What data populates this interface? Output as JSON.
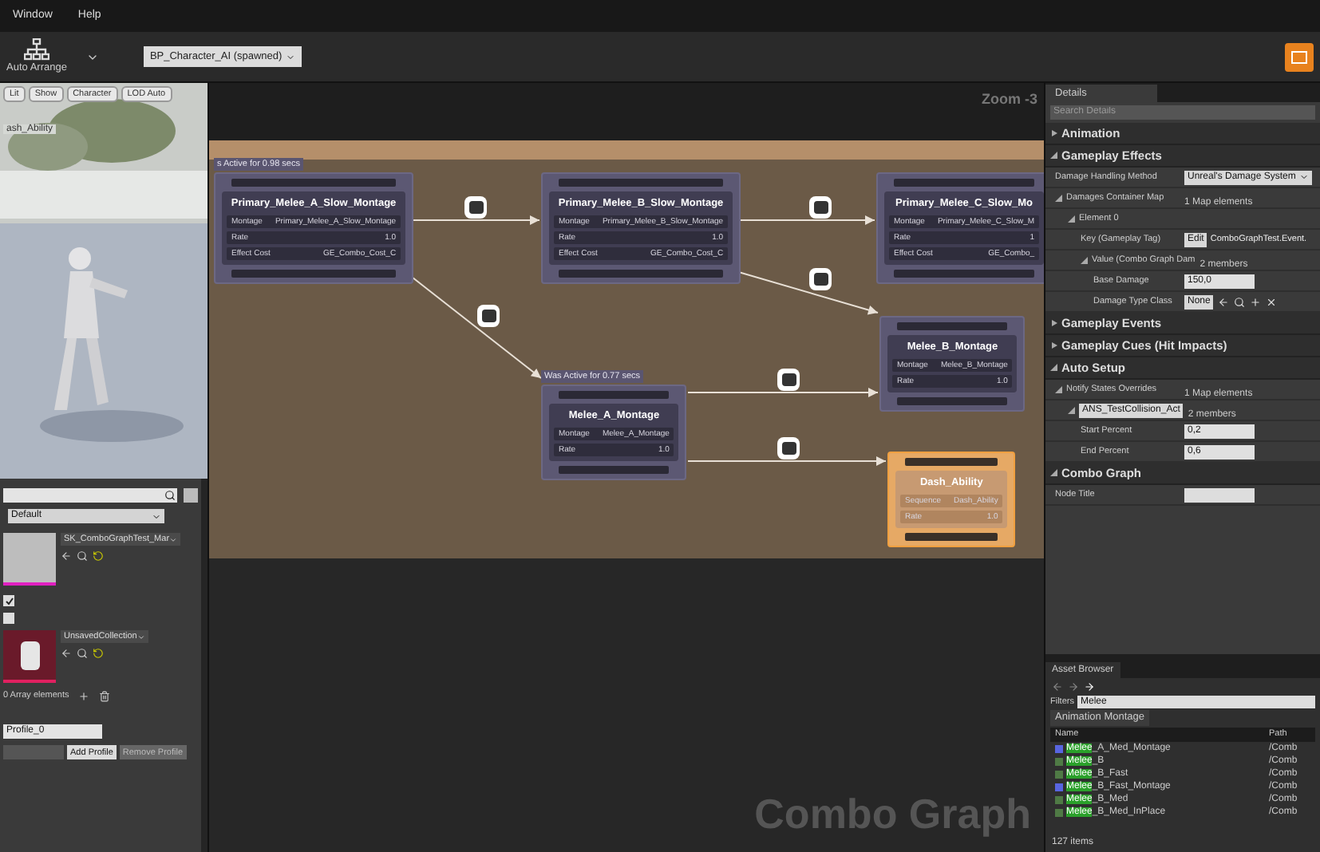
{
  "menu": [
    "Window",
    "Help"
  ],
  "toolbar": {
    "auto_arrange": "Auto Arrange",
    "blueprint_dropdown": "BP_Character_AI (spawned)"
  },
  "viewport": {
    "buttons": [
      "Lit",
      "Show",
      "Character",
      "LOD Auto"
    ],
    "overlay_label": "ash_Ability"
  },
  "preview_panel": {
    "profile_dropdown": "Default",
    "mesh": "SK_ComboGraphTest_Mar",
    "checkboxes": [
      {
        "checked": true
      },
      {
        "checked": false
      }
    ],
    "collection": "UnsavedCollection",
    "array_count": "0 Array elements",
    "profile_name": "Profile_0",
    "buttons": [
      "Add Profile",
      "Remove Profile"
    ]
  },
  "graph": {
    "zoom": "Zoom -3",
    "watermark": "Combo Graph",
    "nodes": [
      {
        "title": "Primary_Melee_A_Slow_Montage",
        "status": "s Active for 0.98 secs",
        "selected": false,
        "rows": [
          {
            "label": "Montage",
            "value": "Primary_Melee_A_Slow_Montage"
          },
          {
            "label": "Rate",
            "value": "1.0"
          },
          {
            "label": "Effect Cost",
            "value": "GE_Combo_Cost_C"
          }
        ]
      },
      {
        "title": "Primary_Melee_B_Slow_Montage",
        "selected": false,
        "rows": [
          {
            "label": "Montage",
            "value": "Primary_Melee_B_Slow_Montage"
          },
          {
            "label": "Rate",
            "value": "1.0"
          },
          {
            "label": "Effect Cost",
            "value": "GE_Combo_Cost_C"
          }
        ]
      },
      {
        "title": "Primary_Melee_C_Slow_Mo",
        "selected": false,
        "rows": [
          {
            "label": "Montage",
            "value": "Primary_Melee_C_Slow_M"
          },
          {
            "label": "Rate",
            "value": "1"
          },
          {
            "label": "Effect Cost",
            "value": "GE_Combo_"
          }
        ]
      },
      {
        "title": "Melee_B_Montage",
        "selected": false,
        "rows": [
          {
            "label": "Montage",
            "value": "Melee_B_Montage"
          },
          {
            "label": "Rate",
            "value": "1.0"
          }
        ]
      },
      {
        "title": "Melee_A_Montage",
        "status": "Was Active for 0.77 secs",
        "selected": false,
        "rows": [
          {
            "label": "Montage",
            "value": "Melee_A_Montage"
          },
          {
            "label": "Rate",
            "value": "1.0"
          }
        ]
      },
      {
        "title": "Dash_Ability",
        "selected": true,
        "rows": [
          {
            "label": "Sequence",
            "value": "Dash_Ability"
          },
          {
            "label": "Rate",
            "value": "1.0"
          }
        ]
      }
    ]
  },
  "details": {
    "tab": "Details",
    "search": {
      "placeholder": "Search Details"
    },
    "sections": [
      {
        "title": "Animation",
        "expanded": false
      },
      {
        "title": "Gameplay Effects",
        "expanded": true,
        "rows": [
          {
            "kind": "dropdown",
            "label": "Damage Handling Method",
            "value": "Unreal's Damage System"
          },
          {
            "kind": "map",
            "label": "Damages Container Map",
            "value": "1 Map elements",
            "expanded": true,
            "children": [
              {
                "kind": "group",
                "label": "Element 0",
                "expanded": true,
                "children": [
                  {
                    "kind": "tag",
                    "label": "Key (Gameplay Tag)",
                    "button": "Edit",
                    "value": "ComboGraphTest.Event."
                  },
                  {
                    "kind": "struct",
                    "label": "Value (Combo Graph Dam",
                    "value": "2 members",
                    "expanded": true,
                    "children": [
                      {
                        "kind": "number",
                        "label": "Base Damage",
                        "value": "150,0"
                      },
                      {
                        "kind": "class",
                        "label": "Damage Type Class",
                        "value": "None"
                      }
                    ]
                  }
                ]
              }
            ]
          }
        ]
      },
      {
        "title": "Gameplay Events",
        "expanded": false
      },
      {
        "title": "Gameplay Cues (Hit Impacts)",
        "expanded": false
      },
      {
        "title": "Auto Setup",
        "expanded": true,
        "rows": [
          {
            "kind": "map",
            "label": "Notify States Overrides",
            "value": "1 Map elements",
            "expanded": true,
            "children": [
              {
                "kind": "keystruct",
                "label": "ANS_TestCollision_Act",
                "value": "2 members",
                "expanded": true,
                "children": [
                  {
                    "kind": "number",
                    "label": "Start Percent",
                    "value": "0,2"
                  },
                  {
                    "kind": "number",
                    "label": "End Percent",
                    "value": "0,6"
                  }
                ]
              }
            ]
          }
        ]
      },
      {
        "title": "Combo Graph",
        "expanded": true,
        "rows": [
          {
            "kind": "text",
            "label": "Node Title"
          }
        ]
      }
    ]
  },
  "asset_browser": {
    "tab": "Asset Browser",
    "filters_label": "Filters",
    "search": "Melee",
    "filter_chip": "Animation Montage",
    "columns": [
      "Name",
      "Path"
    ],
    "rows": [
      {
        "match": "Melee",
        "rest": "_A_Med_Montage",
        "path": "/Comb",
        "color": "#5865e0"
      },
      {
        "match": "Melee",
        "rest": "_B",
        "path": "/Comb",
        "color": "#4f7a45"
      },
      {
        "match": "Melee",
        "rest": "_B_Fast",
        "path": "/Comb",
        "color": "#4f7a45"
      },
      {
        "match": "Melee",
        "rest": "_B_Fast_Montage",
        "path": "/Comb",
        "color": "#5865e0"
      },
      {
        "match": "Melee",
        "rest": "_B_Med",
        "path": "/Comb",
        "color": "#4f7a45"
      },
      {
        "match": "Melee",
        "rest": "_B_Med_InPlace",
        "path": "/Comb",
        "color": "#4f7a45"
      }
    ],
    "status": "127 items"
  }
}
